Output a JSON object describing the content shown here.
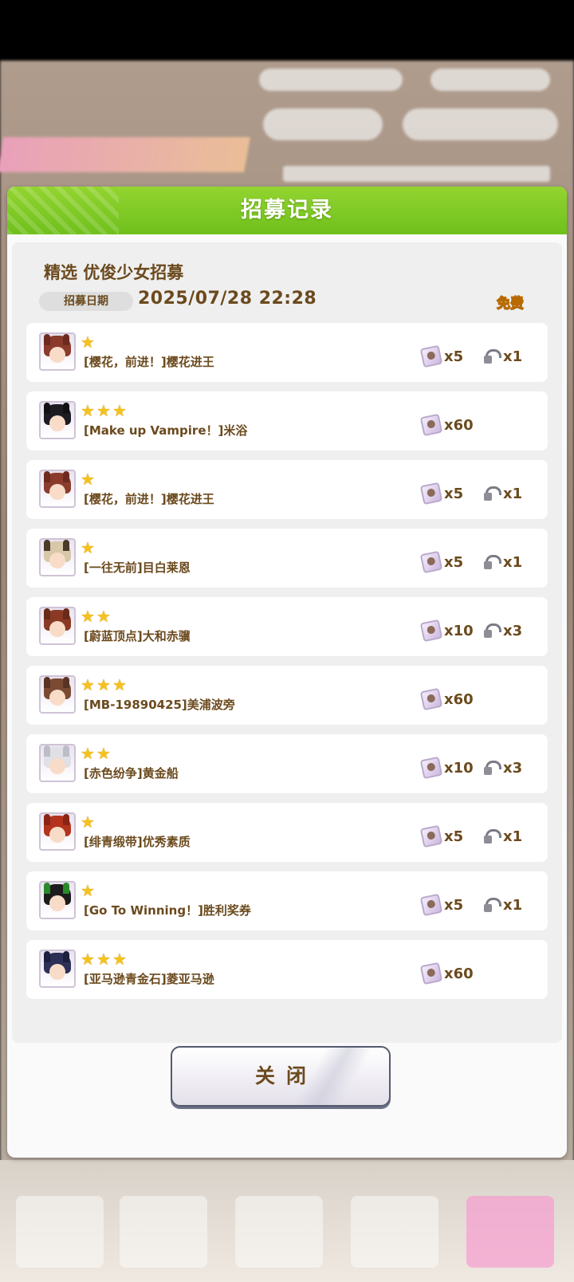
{
  "dialog": {
    "title": "招募记录",
    "banner_name": "精选  优俊少女招募",
    "date_label": "招募日期",
    "date_value": "2025/07/28  22:28",
    "free_badge": "免费",
    "close_label": "关闭"
  },
  "rows": [
    {
      "stars": "★",
      "name": "[樱花，前进！]樱花进王",
      "reward1": "x5",
      "reward2": "x1",
      "hair": "#8a3b2c",
      "ear": "#6e2a1e"
    },
    {
      "stars": "★★★",
      "name": "[Make up Vampire！]米浴",
      "reward1": "x60",
      "reward2": "",
      "hair": "#1e1a22",
      "ear": "#111"
    },
    {
      "stars": "★",
      "name": "[樱花，前进！]樱花进王",
      "reward1": "x5",
      "reward2": "x1",
      "hair": "#8a3b2c",
      "ear": "#6e2a1e"
    },
    {
      "stars": "★",
      "name": "[一往无前]目白莱恩",
      "reward1": "x5",
      "reward2": "x1",
      "hair": "#d8c7a8",
      "ear": "#4a3a2a"
    },
    {
      "stars": "★★",
      "name": "[蔚蓝顶点]大和赤骥",
      "reward1": "x10",
      "reward2": "x3",
      "hair": "#8a3a24",
      "ear": "#6a2a18"
    },
    {
      "stars": "★★★",
      "name": "[MB-19890425]美浦波旁",
      "reward1": "x60",
      "reward2": "",
      "hair": "#7a4a32",
      "ear": "#5a3422"
    },
    {
      "stars": "★★",
      "name": "[赤色纷争]黄金船",
      "reward1": "x10",
      "reward2": "x3",
      "hair": "#e0e0e6",
      "ear": "#bdbdc8"
    },
    {
      "stars": "★",
      "name": "[绯青缎带]优秀素质",
      "reward1": "x5",
      "reward2": "x1",
      "hair": "#b3341e",
      "ear": "#8a2414"
    },
    {
      "stars": "★",
      "name": "[Go To Winning！]胜利奖券",
      "reward1": "x5",
      "reward2": "x1",
      "hair": "#1c1c1c",
      "ear": "#2a8a2a"
    },
    {
      "stars": "★★★",
      "name": "[亚马逊青金石]菱亚马逊",
      "reward1": "x60",
      "reward2": "",
      "hair": "#2c2f56",
      "ear": "#1c1f3e"
    }
  ],
  "colors": {
    "header_green": "#7cc726",
    "text_brown": "#6b4a1e",
    "star_yellow": "#f6c21b"
  }
}
